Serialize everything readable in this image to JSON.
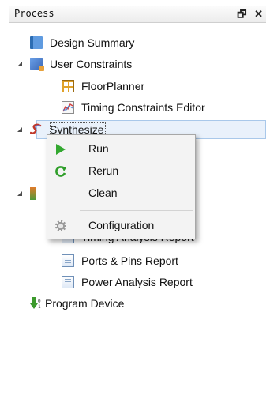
{
  "panel": {
    "title": "Process",
    "float_btn": "🗗",
    "close_btn": "✕"
  },
  "tree": {
    "design_summary": "Design Summary",
    "user_constraints": "User Constraints",
    "floorplanner": "FloorPlanner",
    "timing_constraints_editor": "Timing Constraints Editor",
    "synthesize": "Synthesize",
    "report_partial": "rt",
    "timing_analysis_report": "Timing Analysis Report",
    "ports_pins_report": "Ports & Pins Report",
    "power_analysis_report": "Power Analysis Report",
    "program_device": "Program Device"
  },
  "context_menu": {
    "run": "Run",
    "rerun": "Rerun",
    "clean": "Clean",
    "configuration": "Configuration"
  }
}
